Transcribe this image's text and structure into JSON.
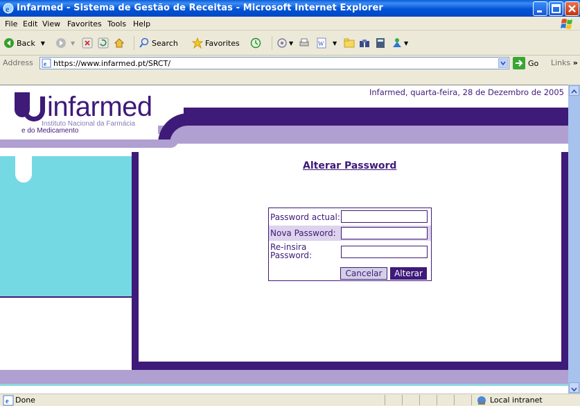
{
  "window": {
    "title": "Infarmed - Sistema de Gestão de Receitas - Microsoft Internet Explorer"
  },
  "menu": {
    "items": [
      "File",
      "Edit",
      "View",
      "Favorites",
      "Tools",
      "Help"
    ]
  },
  "toolbar": {
    "back_label": "Back",
    "search_label": "Search",
    "favorites_label": "Favorites"
  },
  "address": {
    "label": "Address",
    "url": "https://www.infarmed.pt/SRCT/",
    "go_label": "Go",
    "links_label": "Links"
  },
  "page": {
    "date_text": "Infarmed, quarta-feira, 28 de Dezembro de 2005",
    "logo": {
      "word": "infarmed",
      "sub1": "Instituto Nacional da Farmácia",
      "sub2": "e do Medicamento"
    },
    "heading": "Alterar Password",
    "form": {
      "current_label": "Password actual:",
      "new_label": "Nova Password:",
      "reenter_label_line1": "Re-insira",
      "reenter_label_line2": "Password:",
      "current_value": "",
      "new_value": "",
      "reenter_value": "",
      "cancel_label": "Cancelar",
      "submit_label": "Alterar"
    }
  },
  "status": {
    "text": "Done",
    "zone": "Local intranet"
  },
  "colors": {
    "brand_purple": "#3e1a79",
    "brand_lavender": "#b09fd1",
    "brand_cyan": "#75d9e4",
    "xp_titlebar": "#0053d6"
  }
}
